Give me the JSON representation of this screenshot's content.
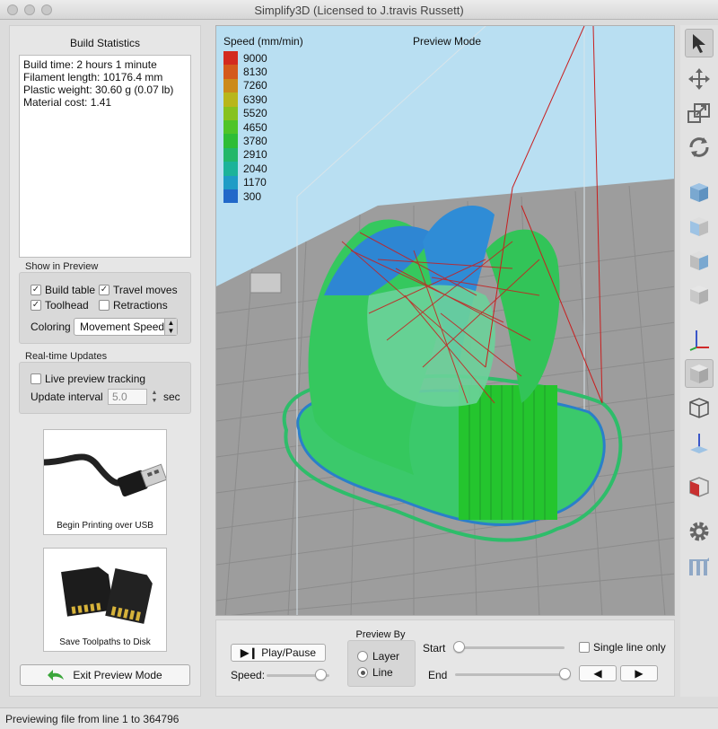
{
  "window": {
    "title": "Simplify3D (Licensed to J.travis Russett)"
  },
  "build_statistics": {
    "heading": "Build Statistics",
    "lines": [
      "Build time: 2 hours 1 minute",
      "Filament length: 10176.4 mm",
      "Plastic weight: 30.60 g (0.07 lb)",
      "Material cost: 1.41"
    ]
  },
  "show_in_preview": {
    "label": "Show in Preview",
    "build_table": {
      "label": "Build table",
      "checked": true
    },
    "travel_moves": {
      "label": "Travel moves",
      "checked": true
    },
    "toolhead": {
      "label": "Toolhead",
      "checked": true
    },
    "retractions": {
      "label": "Retractions",
      "checked": false
    },
    "coloring_label": "Coloring",
    "coloring_value": "Movement Speed"
  },
  "realtime_updates": {
    "label": "Real-time Updates",
    "live_tracking": {
      "label": "Live preview tracking",
      "checked": false
    },
    "interval_label": "Update interval",
    "interval_value": "5.0",
    "interval_unit": "sec"
  },
  "tiles": {
    "usb": "Begin Printing over USB",
    "sd": "Save Toolpaths to Disk"
  },
  "exit_button": "Exit Preview Mode",
  "viewport": {
    "legend_title": "Speed (mm/min)",
    "mode_label": "Preview Mode",
    "legend": [
      {
        "value": "9000",
        "color": "#d32a1f"
      },
      {
        "value": "8130",
        "color": "#d45a1c"
      },
      {
        "value": "7260",
        "color": "#cc8a1a"
      },
      {
        "value": "6390",
        "color": "#b8b61b"
      },
      {
        "value": "5520",
        "color": "#86c220"
      },
      {
        "value": "4650",
        "color": "#4ec428"
      },
      {
        "value": "3780",
        "color": "#2ebd36"
      },
      {
        "value": "2910",
        "color": "#22b76a"
      },
      {
        "value": "2040",
        "color": "#1cb39a"
      },
      {
        "value": "1170",
        "color": "#1e9cc6"
      },
      {
        "value": "300",
        "color": "#2168c9"
      }
    ]
  },
  "controls": {
    "play_pause": "Play/Pause",
    "speed_label": "Speed:",
    "speed_fraction": 0.85,
    "preview_by_label": "Preview By",
    "layer_label": "Layer",
    "line_label": "Line",
    "selected": "line",
    "start_label": "Start",
    "start_fraction": 0.0,
    "end_label": "End",
    "end_fraction": 1.0,
    "single_line_label": "Single line only",
    "single_line_checked": false
  },
  "status": "Previewing file from line 1 to 364796"
}
